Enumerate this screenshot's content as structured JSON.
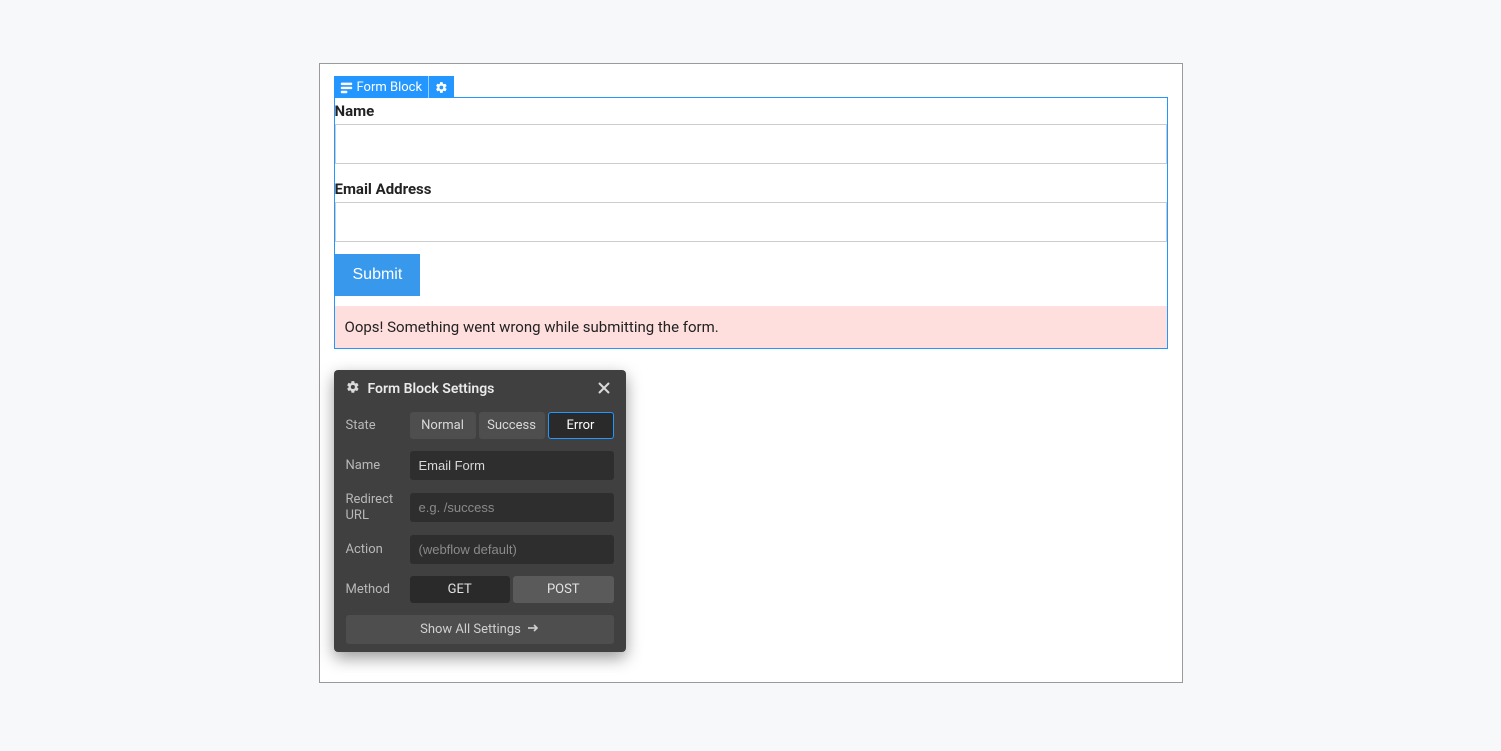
{
  "selection": {
    "label": "Form Block"
  },
  "form": {
    "name_label": "Name",
    "email_label": "Email Address",
    "submit_label": "Submit",
    "error_message": "Oops! Something went wrong while submitting the form."
  },
  "settings": {
    "title": "Form Block Settings",
    "state": {
      "label": "State",
      "options": [
        "Normal",
        "Success",
        "Error"
      ],
      "selected": "Error"
    },
    "name": {
      "label": "Name",
      "value": "Email Form"
    },
    "redirect": {
      "label": "Redirect URL",
      "placeholder": "e.g. /success",
      "value": ""
    },
    "action": {
      "label": "Action",
      "placeholder": "(webflow default)",
      "value": ""
    },
    "method": {
      "label": "Method",
      "options": [
        "GET",
        "POST"
      ],
      "selected": "GET"
    },
    "show_all": "Show All Settings"
  }
}
